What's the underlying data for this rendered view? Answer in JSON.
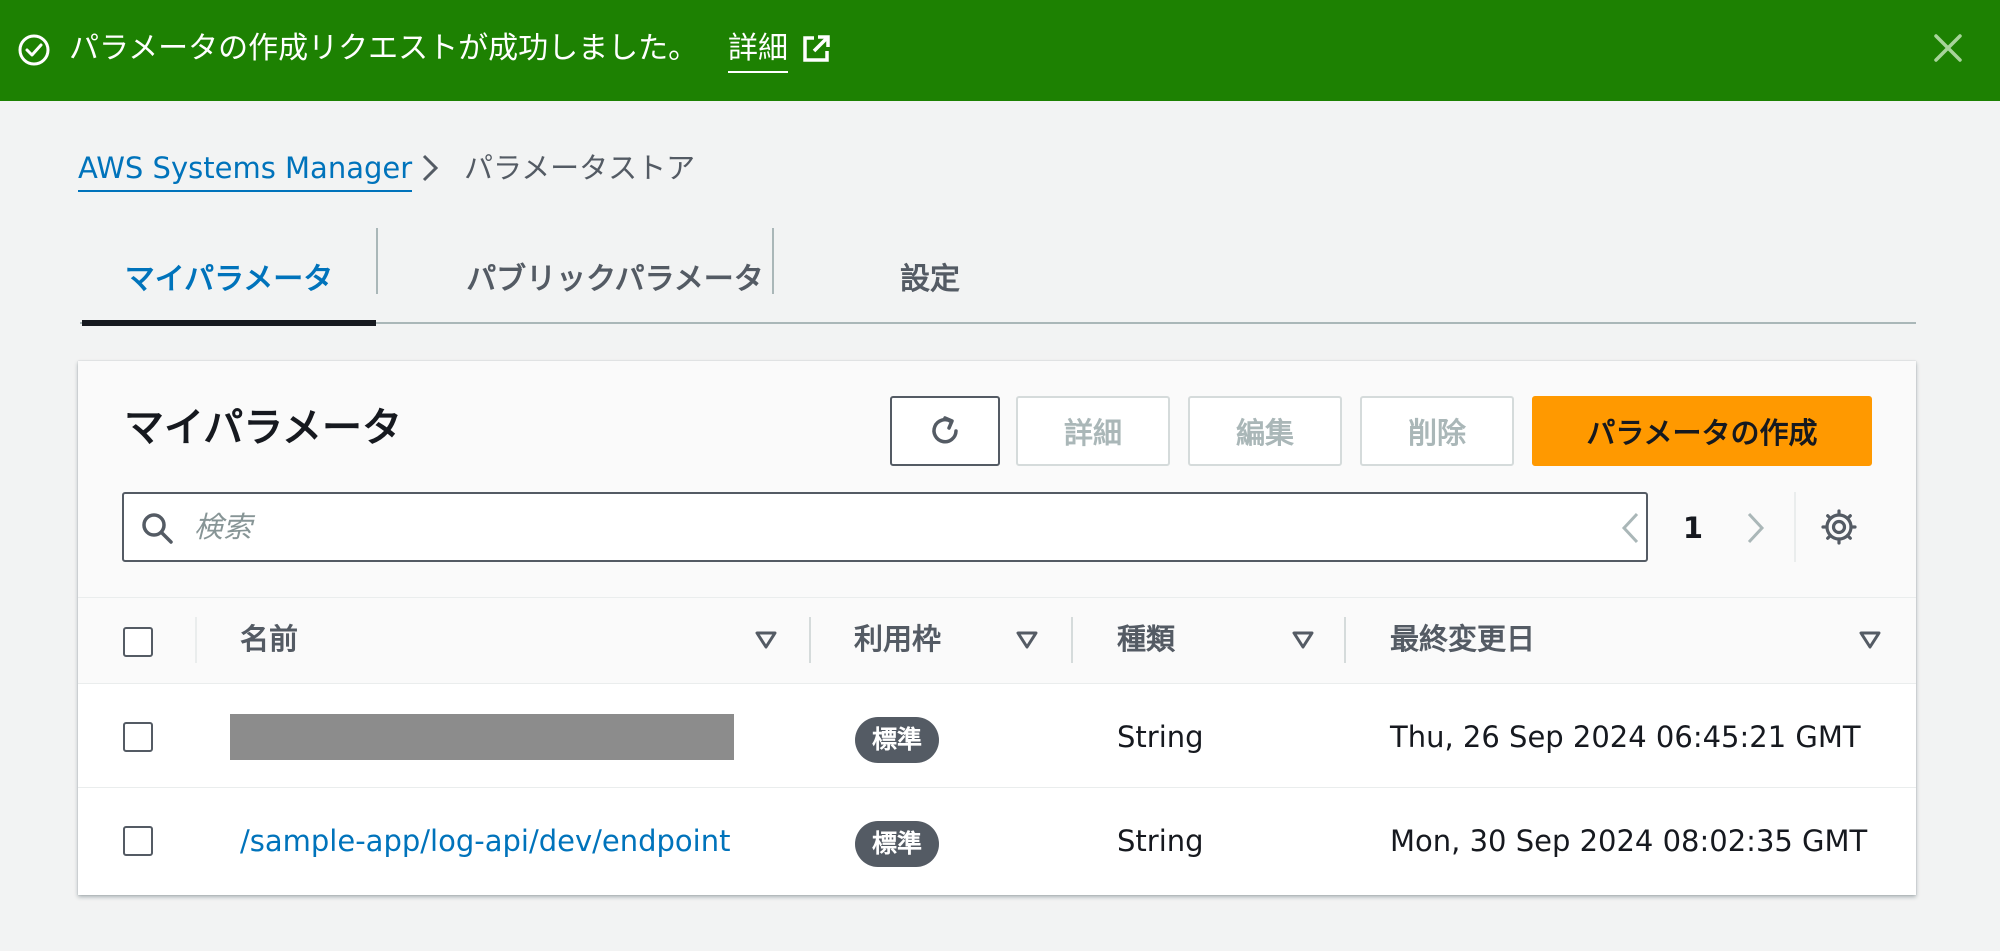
{
  "flash": {
    "message": "パラメータの作成リクエストが成功しました。",
    "details_link": "詳細",
    "color": "#1d8102"
  },
  "breadcrumb": {
    "root": "AWS Systems Manager",
    "current": "パラメータストア"
  },
  "tabs": [
    {
      "label": "マイパラメータ",
      "active": true
    },
    {
      "label": "パブリックパラメータ",
      "active": false
    },
    {
      "label": "設定",
      "active": false
    }
  ],
  "panel": {
    "title": "マイパラメータ",
    "buttons": {
      "details": "詳細",
      "edit": "編集",
      "delete": "削除",
      "create": "パラメータの作成"
    },
    "search_placeholder": "検索",
    "page": "1"
  },
  "table": {
    "columns": [
      "名前",
      "利用枠",
      "種類",
      "最終変更日"
    ],
    "rows": [
      {
        "name": "",
        "name_redacted": true,
        "tier": "標準",
        "type": "String",
        "modified": "Thu, 26 Sep 2024 06:45:21 GMT"
      },
      {
        "name": "/sample-app/log-api/dev/endpoint",
        "name_redacted": false,
        "tier": "標準",
        "type": "String",
        "modified": "Mon, 30 Sep 2024 08:02:35 GMT"
      }
    ]
  },
  "colors": {
    "link": "#0073bb",
    "primary_button": "#ff9900",
    "badge": "#545b64"
  },
  "icons": {
    "flash": "check-circle-icon",
    "external": "external-link-icon",
    "close": "close-icon",
    "separator": "chevron-right-icon",
    "refresh": "refresh-icon",
    "search": "search-icon",
    "prev": "chevron-left-icon",
    "next": "chevron-right-icon",
    "settings": "gear-icon",
    "sort": "sort-down-icon"
  }
}
